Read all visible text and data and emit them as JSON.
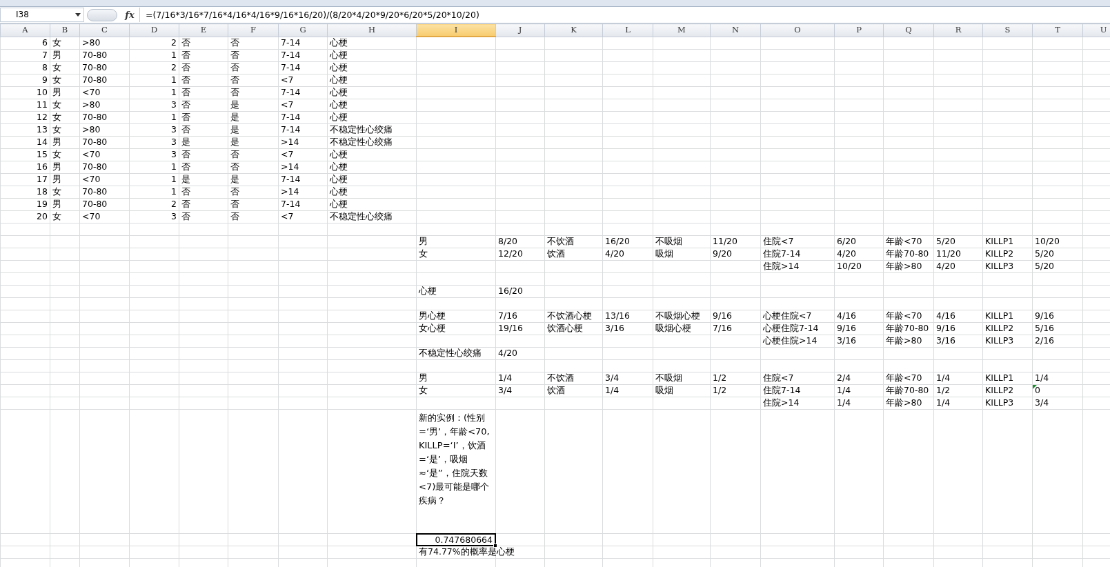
{
  "formula_bar": {
    "cell_ref": "I38",
    "fx_label": "fx",
    "formula": "=(7/16*3/16*7/16*4/16*4/16*9/16*16/20)/(8/20*4/20*9/20*6/20*5/20*10/20)"
  },
  "columns": [
    {
      "label": "A",
      "selected": false
    },
    {
      "label": "B",
      "selected": false
    },
    {
      "label": "C",
      "selected": false
    },
    {
      "label": "D",
      "selected": false
    },
    {
      "label": "E",
      "selected": false
    },
    {
      "label": "F",
      "selected": false
    },
    {
      "label": "G",
      "selected": false
    },
    {
      "label": "H",
      "selected": false
    },
    {
      "label": "I",
      "selected": true
    },
    {
      "label": "J",
      "selected": false
    },
    {
      "label": "K",
      "selected": false
    },
    {
      "label": "L",
      "selected": false
    },
    {
      "label": "M",
      "selected": false
    },
    {
      "label": "N",
      "selected": false
    },
    {
      "label": "O",
      "selected": false
    },
    {
      "label": "P",
      "selected": false
    },
    {
      "label": "Q",
      "selected": false
    },
    {
      "label": "R",
      "selected": false
    },
    {
      "label": "S",
      "selected": false
    },
    {
      "label": "T",
      "selected": false
    },
    {
      "label": "U",
      "selected": false
    }
  ],
  "rows": [
    {
      "kind": "normal",
      "cells": {
        "A": {
          "kind": "number",
          "text": "6",
          "selected": false
        },
        "B": {
          "kind": "text",
          "text": "女",
          "selected": false
        },
        "C": {
          "kind": "text",
          "text": ">80",
          "selected": false
        },
        "D": {
          "kind": "number",
          "text": "2",
          "selected": false
        },
        "E": {
          "kind": "text",
          "text": "否",
          "selected": false
        },
        "F": {
          "kind": "text",
          "text": "否",
          "selected": false
        },
        "G": {
          "kind": "text",
          "text": "7-14",
          "selected": false
        },
        "H": {
          "kind": "text",
          "text": "心梗",
          "selected": false
        }
      }
    },
    {
      "kind": "normal",
      "cells": {
        "A": {
          "kind": "number",
          "text": "7",
          "selected": false
        },
        "B": {
          "kind": "text",
          "text": "男",
          "selected": false
        },
        "C": {
          "kind": "text",
          "text": "70-80",
          "selected": false
        },
        "D": {
          "kind": "number",
          "text": "1",
          "selected": false
        },
        "E": {
          "kind": "text",
          "text": "否",
          "selected": false
        },
        "F": {
          "kind": "text",
          "text": "否",
          "selected": false
        },
        "G": {
          "kind": "text",
          "text": "7-14",
          "selected": false
        },
        "H": {
          "kind": "text",
          "text": "心梗",
          "selected": false
        }
      }
    },
    {
      "kind": "normal",
      "cells": {
        "A": {
          "kind": "number",
          "text": "8",
          "selected": false
        },
        "B": {
          "kind": "text",
          "text": "女",
          "selected": false
        },
        "C": {
          "kind": "text",
          "text": "70-80",
          "selected": false
        },
        "D": {
          "kind": "number",
          "text": "2",
          "selected": false
        },
        "E": {
          "kind": "text",
          "text": "否",
          "selected": false
        },
        "F": {
          "kind": "text",
          "text": "否",
          "selected": false
        },
        "G": {
          "kind": "text",
          "text": "7-14",
          "selected": false
        },
        "H": {
          "kind": "text",
          "text": "心梗",
          "selected": false
        }
      }
    },
    {
      "kind": "normal",
      "cells": {
        "A": {
          "kind": "number",
          "text": "9",
          "selected": false
        },
        "B": {
          "kind": "text",
          "text": "女",
          "selected": false
        },
        "C": {
          "kind": "text",
          "text": "70-80",
          "selected": false
        },
        "D": {
          "kind": "number",
          "text": "1",
          "selected": false
        },
        "E": {
          "kind": "text",
          "text": "否",
          "selected": false
        },
        "F": {
          "kind": "text",
          "text": "否",
          "selected": false
        },
        "G": {
          "kind": "text",
          "text": "<7",
          "selected": false
        },
        "H": {
          "kind": "text",
          "text": "心梗",
          "selected": false
        }
      }
    },
    {
      "kind": "normal",
      "cells": {
        "A": {
          "kind": "number",
          "text": "10",
          "selected": false
        },
        "B": {
          "kind": "text",
          "text": "男",
          "selected": false
        },
        "C": {
          "kind": "text",
          "text": "<70",
          "selected": false
        },
        "D": {
          "kind": "number",
          "text": "1",
          "selected": false
        },
        "E": {
          "kind": "text",
          "text": "否",
          "selected": false
        },
        "F": {
          "kind": "text",
          "text": "否",
          "selected": false
        },
        "G": {
          "kind": "text",
          "text": "7-14",
          "selected": false
        },
        "H": {
          "kind": "text",
          "text": "心梗",
          "selected": false
        }
      }
    },
    {
      "kind": "normal",
      "cells": {
        "A": {
          "kind": "number",
          "text": "11",
          "selected": false
        },
        "B": {
          "kind": "text",
          "text": "女",
          "selected": false
        },
        "C": {
          "kind": "text",
          "text": ">80",
          "selected": false
        },
        "D": {
          "kind": "number",
          "text": "3",
          "selected": false
        },
        "E": {
          "kind": "text",
          "text": "否",
          "selected": false
        },
        "F": {
          "kind": "text",
          "text": "是",
          "selected": false
        },
        "G": {
          "kind": "text",
          "text": "<7",
          "selected": false
        },
        "H": {
          "kind": "text",
          "text": "心梗",
          "selected": false
        }
      }
    },
    {
      "kind": "normal",
      "cells": {
        "A": {
          "kind": "number",
          "text": "12",
          "selected": false
        },
        "B": {
          "kind": "text",
          "text": "女",
          "selected": false
        },
        "C": {
          "kind": "text",
          "text": "70-80",
          "selected": false
        },
        "D": {
          "kind": "number",
          "text": "1",
          "selected": false
        },
        "E": {
          "kind": "text",
          "text": "否",
          "selected": false
        },
        "F": {
          "kind": "text",
          "text": "是",
          "selected": false
        },
        "G": {
          "kind": "text",
          "text": "7-14",
          "selected": false
        },
        "H": {
          "kind": "text",
          "text": "心梗",
          "selected": false
        }
      }
    },
    {
      "kind": "normal",
      "cells": {
        "A": {
          "kind": "number",
          "text": "13",
          "selected": false
        },
        "B": {
          "kind": "text",
          "text": "女",
          "selected": false
        },
        "C": {
          "kind": "text",
          "text": ">80",
          "selected": false
        },
        "D": {
          "kind": "number",
          "text": "3",
          "selected": false
        },
        "E": {
          "kind": "text",
          "text": "否",
          "selected": false
        },
        "F": {
          "kind": "text",
          "text": "是",
          "selected": false
        },
        "G": {
          "kind": "text",
          "text": "7-14",
          "selected": false
        },
        "H": {
          "kind": "text",
          "text": "不稳定性心绞痛",
          "selected": false
        }
      }
    },
    {
      "kind": "normal",
      "cells": {
        "A": {
          "kind": "number",
          "text": "14",
          "selected": false
        },
        "B": {
          "kind": "text",
          "text": "男",
          "selected": false
        },
        "C": {
          "kind": "text",
          "text": "70-80",
          "selected": false
        },
        "D": {
          "kind": "number",
          "text": "3",
          "selected": false
        },
        "E": {
          "kind": "text",
          "text": "是",
          "selected": false
        },
        "F": {
          "kind": "text",
          "text": "是",
          "selected": false
        },
        "G": {
          "kind": "text",
          "text": ">14",
          "selected": false
        },
        "H": {
          "kind": "text",
          "text": "不稳定性心绞痛",
          "selected": false
        }
      }
    },
    {
      "kind": "normal",
      "cells": {
        "A": {
          "kind": "number",
          "text": "15",
          "selected": false
        },
        "B": {
          "kind": "text",
          "text": "女",
          "selected": false
        },
        "C": {
          "kind": "text",
          "text": "<70",
          "selected": false
        },
        "D": {
          "kind": "number",
          "text": "3",
          "selected": false
        },
        "E": {
          "kind": "text",
          "text": "否",
          "selected": false
        },
        "F": {
          "kind": "text",
          "text": "否",
          "selected": false
        },
        "G": {
          "kind": "text",
          "text": "<7",
          "selected": false
        },
        "H": {
          "kind": "text",
          "text": "心梗",
          "selected": false
        }
      }
    },
    {
      "kind": "normal",
      "cells": {
        "A": {
          "kind": "number",
          "text": "16",
          "selected": false
        },
        "B": {
          "kind": "text",
          "text": "男",
          "selected": false
        },
        "C": {
          "kind": "text",
          "text": "70-80",
          "selected": false
        },
        "D": {
          "kind": "number",
          "text": "1",
          "selected": false
        },
        "E": {
          "kind": "text",
          "text": "否",
          "selected": false
        },
        "F": {
          "kind": "text",
          "text": "否",
          "selected": false
        },
        "G": {
          "kind": "text",
          "text": ">14",
          "selected": false
        },
        "H": {
          "kind": "text",
          "text": "心梗",
          "selected": false
        }
      }
    },
    {
      "kind": "normal",
      "cells": {
        "A": {
          "kind": "number",
          "text": "17",
          "selected": false
        },
        "B": {
          "kind": "text",
          "text": "男",
          "selected": false
        },
        "C": {
          "kind": "text",
          "text": "<70",
          "selected": false
        },
        "D": {
          "kind": "number",
          "text": "1",
          "selected": false
        },
        "E": {
          "kind": "text",
          "text": "是",
          "selected": false
        },
        "F": {
          "kind": "text",
          "text": "是",
          "selected": false
        },
        "G": {
          "kind": "text",
          "text": "7-14",
          "selected": false
        },
        "H": {
          "kind": "text",
          "text": "心梗",
          "selected": false
        }
      }
    },
    {
      "kind": "normal",
      "cells": {
        "A": {
          "kind": "number",
          "text": "18",
          "selected": false
        },
        "B": {
          "kind": "text",
          "text": "女",
          "selected": false
        },
        "C": {
          "kind": "text",
          "text": "70-80",
          "selected": false
        },
        "D": {
          "kind": "number",
          "text": "1",
          "selected": false
        },
        "E": {
          "kind": "text",
          "text": "否",
          "selected": false
        },
        "F": {
          "kind": "text",
          "text": "否",
          "selected": false
        },
        "G": {
          "kind": "text",
          "text": ">14",
          "selected": false
        },
        "H": {
          "kind": "text",
          "text": "心梗",
          "selected": false
        }
      }
    },
    {
      "kind": "normal",
      "cells": {
        "A": {
          "kind": "number",
          "text": "19",
          "selected": false
        },
        "B": {
          "kind": "text",
          "text": "男",
          "selected": false
        },
        "C": {
          "kind": "text",
          "text": "70-80",
          "selected": false
        },
        "D": {
          "kind": "number",
          "text": "2",
          "selected": false
        },
        "E": {
          "kind": "text",
          "text": "否",
          "selected": false
        },
        "F": {
          "kind": "text",
          "text": "否",
          "selected": false
        },
        "G": {
          "kind": "text",
          "text": "7-14",
          "selected": false
        },
        "H": {
          "kind": "text",
          "text": "心梗",
          "selected": false
        }
      }
    },
    {
      "kind": "normal",
      "cells": {
        "A": {
          "kind": "number",
          "text": "20",
          "selected": false
        },
        "B": {
          "kind": "text",
          "text": "女",
          "selected": false
        },
        "C": {
          "kind": "text",
          "text": "<70",
          "selected": false
        },
        "D": {
          "kind": "number",
          "text": "3",
          "selected": false
        },
        "E": {
          "kind": "text",
          "text": "否",
          "selected": false
        },
        "F": {
          "kind": "text",
          "text": "否",
          "selected": false
        },
        "G": {
          "kind": "text",
          "text": "<7",
          "selected": false
        },
        "H": {
          "kind": "text",
          "text": "不稳定性心绞痛",
          "selected": false
        }
      }
    },
    {
      "kind": "empty"
    },
    {
      "kind": "normal",
      "cells": {
        "I": {
          "kind": "text",
          "text": "男",
          "selected": false
        },
        "J": {
          "kind": "text",
          "text": "8/20",
          "selected": false
        },
        "K": {
          "kind": "text",
          "text": "不饮酒",
          "selected": false
        },
        "L": {
          "kind": "text",
          "text": "16/20",
          "selected": false
        },
        "M": {
          "kind": "text",
          "text": "不吸烟",
          "selected": false
        },
        "N": {
          "kind": "text",
          "text": "11/20",
          "selected": false
        },
        "O": {
          "kind": "text",
          "text": "住院<7",
          "selected": false
        },
        "P": {
          "kind": "text",
          "text": "6/20",
          "selected": false
        },
        "Q": {
          "kind": "text",
          "text": "年龄<70",
          "selected": false
        },
        "R": {
          "kind": "text",
          "text": "5/20",
          "selected": false
        },
        "S": {
          "kind": "text",
          "text": "KILLP1",
          "selected": false
        },
        "T": {
          "kind": "text",
          "text": "10/20",
          "selected": false
        }
      }
    },
    {
      "kind": "normal",
      "cells": {
        "I": {
          "kind": "text",
          "text": "女",
          "selected": false
        },
        "J": {
          "kind": "text",
          "text": "12/20",
          "selected": false
        },
        "K": {
          "kind": "text",
          "text": "饮酒",
          "selected": false
        },
        "L": {
          "kind": "text",
          "text": "4/20",
          "selected": false
        },
        "M": {
          "kind": "text",
          "text": "吸烟",
          "selected": false
        },
        "N": {
          "kind": "text",
          "text": "9/20",
          "selected": false
        },
        "O": {
          "kind": "text",
          "text": "住院7-14",
          "selected": false
        },
        "P": {
          "kind": "text",
          "text": "4/20",
          "selected": false
        },
        "Q": {
          "kind": "text",
          "text": "年龄70-80",
          "selected": false
        },
        "R": {
          "kind": "text",
          "text": "11/20",
          "selected": false
        },
        "S": {
          "kind": "text",
          "text": "KILLP2",
          "selected": false
        },
        "T": {
          "kind": "text",
          "text": "5/20",
          "selected": false
        }
      }
    },
    {
      "kind": "normal",
      "cells": {
        "O": {
          "kind": "text",
          "text": "住院>14",
          "selected": false
        },
        "P": {
          "kind": "text",
          "text": "10/20",
          "selected": false
        },
        "Q": {
          "kind": "text",
          "text": "年龄>80",
          "selected": false
        },
        "R": {
          "kind": "text",
          "text": "4/20",
          "selected": false
        },
        "S": {
          "kind": "text",
          "text": "KILLP3",
          "selected": false
        },
        "T": {
          "kind": "text",
          "text": "5/20",
          "selected": false
        }
      }
    },
    {
      "kind": "empty"
    },
    {
      "kind": "normal",
      "cells": {
        "I": {
          "kind": "text",
          "text": "心梗",
          "selected": false
        },
        "J": {
          "kind": "text",
          "text": "16/20",
          "selected": false
        }
      }
    },
    {
      "kind": "empty"
    },
    {
      "kind": "normal",
      "cells": {
        "I": {
          "kind": "text",
          "text": "男心梗",
          "selected": false
        },
        "J": {
          "kind": "text",
          "text": "7/16",
          "selected": false
        },
        "K": {
          "kind": "text",
          "text": "不饮酒心梗",
          "selected": false
        },
        "L": {
          "kind": "text",
          "text": "13/16",
          "selected": false
        },
        "M": {
          "kind": "text",
          "text": "不吸烟心梗",
          "selected": false
        },
        "N": {
          "kind": "text",
          "text": "9/16",
          "selected": false
        },
        "O": {
          "kind": "text",
          "text": "心梗住院<7",
          "selected": false
        },
        "P": {
          "kind": "text",
          "text": "4/16",
          "selected": false
        },
        "Q": {
          "kind": "text",
          "text": "年龄<70",
          "selected": false
        },
        "R": {
          "kind": "text",
          "text": "4/16",
          "selected": false
        },
        "S": {
          "kind": "text",
          "text": "KILLP1",
          "selected": false
        },
        "T": {
          "kind": "text",
          "text": "9/16",
          "selected": false
        }
      }
    },
    {
      "kind": "normal",
      "cells": {
        "I": {
          "kind": "text",
          "text": "女心梗",
          "selected": false
        },
        "J": {
          "kind": "text",
          "text": "19/16",
          "selected": false
        },
        "K": {
          "kind": "text",
          "text": "饮酒心梗",
          "selected": false
        },
        "L": {
          "kind": "text",
          "text": "3/16",
          "selected": false
        },
        "M": {
          "kind": "text",
          "text": "吸烟心梗",
          "selected": false
        },
        "N": {
          "kind": "text",
          "text": "7/16",
          "selected": false
        },
        "O": {
          "kind": "text",
          "text": "心梗住院7-14",
          "selected": false
        },
        "P": {
          "kind": "text",
          "text": "9/16",
          "selected": false
        },
        "Q": {
          "kind": "text",
          "text": "年龄70-80",
          "selected": false
        },
        "R": {
          "kind": "text",
          "text": "9/16",
          "selected": false
        },
        "S": {
          "kind": "text",
          "text": "KILLP2",
          "selected": false
        },
        "T": {
          "kind": "text",
          "text": "5/16",
          "selected": false
        }
      }
    },
    {
      "kind": "normal",
      "cells": {
        "O": {
          "kind": "text",
          "text": "心梗住院>14",
          "selected": false
        },
        "P": {
          "kind": "text",
          "text": "3/16",
          "selected": false
        },
        "Q": {
          "kind": "text",
          "text": "年龄>80",
          "selected": false
        },
        "R": {
          "kind": "text",
          "text": "3/16",
          "selected": false
        },
        "S": {
          "kind": "text",
          "text": "KILLP3",
          "selected": false
        },
        "T": {
          "kind": "text",
          "text": "2/16",
          "selected": false
        }
      }
    },
    {
      "kind": "normal",
      "cells": {
        "I": {
          "kind": "text",
          "text": "不稳定性心绞痛",
          "selected": false
        },
        "J": {
          "kind": "text",
          "text": "4/20",
          "selected": false
        }
      }
    },
    {
      "kind": "empty"
    },
    {
      "kind": "normal",
      "cells": {
        "I": {
          "kind": "text",
          "text": "男",
          "selected": false
        },
        "J": {
          "kind": "text",
          "text": "1/4",
          "selected": false
        },
        "K": {
          "kind": "text",
          "text": "不饮酒",
          "selected": false
        },
        "L": {
          "kind": "text",
          "text": "3/4",
          "selected": false
        },
        "M": {
          "kind": "text",
          "text": "不吸烟",
          "selected": false
        },
        "N": {
          "kind": "text",
          "text": "1/2",
          "selected": false
        },
        "O": {
          "kind": "text",
          "text": "住院<7",
          "selected": false
        },
        "P": {
          "kind": "text",
          "text": "2/4",
          "selected": false
        },
        "Q": {
          "kind": "text",
          "text": "年龄<70",
          "selected": false
        },
        "R": {
          "kind": "text",
          "text": "1/4",
          "selected": false
        },
        "S": {
          "kind": "text",
          "text": "KILLP1",
          "selected": false
        },
        "T": {
          "kind": "text",
          "text": "1/4",
          "selected": false
        }
      }
    },
    {
      "kind": "normal",
      "cells": {
        "I": {
          "kind": "text",
          "text": "女",
          "selected": false
        },
        "J": {
          "kind": "text",
          "text": "3/4",
          "selected": false
        },
        "K": {
          "kind": "text",
          "text": "饮酒",
          "selected": false
        },
        "L": {
          "kind": "text",
          "text": "1/4",
          "selected": false
        },
        "M": {
          "kind": "text",
          "text": "吸烟",
          "selected": false
        },
        "N": {
          "kind": "text",
          "text": "1/2",
          "selected": false
        },
        "O": {
          "kind": "text",
          "text": "住院7-14",
          "selected": false
        },
        "P": {
          "kind": "text",
          "text": "1/4",
          "selected": false
        },
        "Q": {
          "kind": "text",
          "text": "年龄70-80",
          "selected": false
        },
        "R": {
          "kind": "text",
          "text": "1/2",
          "selected": false
        },
        "S": {
          "kind": "text",
          "text": "KILLP2",
          "selected": false
        },
        "T": {
          "kind": "flagged",
          "text": "0",
          "selected": false
        }
      }
    },
    {
      "kind": "normal",
      "cells": {
        "O": {
          "kind": "text",
          "text": "住院>14",
          "selected": false
        },
        "P": {
          "kind": "text",
          "text": "1/4",
          "selected": false
        },
        "Q": {
          "kind": "text",
          "text": "年龄>80",
          "selected": false
        },
        "R": {
          "kind": "text",
          "text": "1/4",
          "selected": false
        },
        "S": {
          "kind": "text",
          "text": "KILLP3",
          "selected": false
        },
        "T": {
          "kind": "text",
          "text": "3/4",
          "selected": false
        }
      }
    },
    {
      "kind": "tall",
      "cells": {
        "I": {
          "kind": "text",
          "text": "新的实例：(性别=‘男’，年龄<70,KILLP=‘I’，饮酒=‘是’，吸烟≈‘是”，住院天数<7)最可能是哪个疾病？",
          "selected": false
        }
      }
    },
    {
      "kind": "normal",
      "cells": {
        "I": {
          "kind": "number",
          "text": "0.747680664",
          "selected": true
        }
      }
    },
    {
      "kind": "normal",
      "cells": {
        "I": {
          "kind": "text",
          "text": "有74.77%的概率是心梗",
          "selected": false
        }
      }
    },
    {
      "kind": "empty"
    }
  ]
}
